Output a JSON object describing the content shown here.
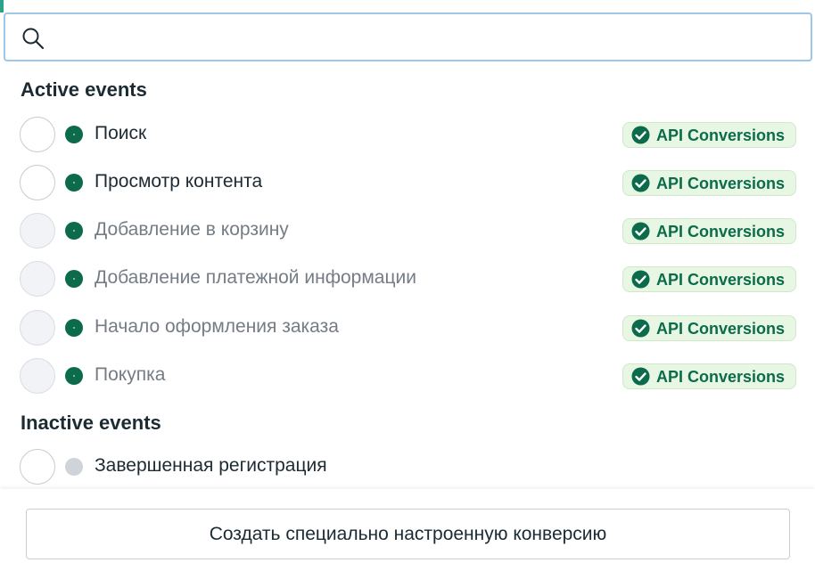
{
  "search": {
    "value": "",
    "placeholder": ""
  },
  "sections": {
    "active_title": "Active events",
    "inactive_title": "Inactive events"
  },
  "active_events": [
    {
      "label": "Поиск",
      "badge": "API Conversions",
      "enabled": true
    },
    {
      "label": "Просмотр контента",
      "badge": "API Conversions",
      "enabled": true
    },
    {
      "label": "Добавление в корзину",
      "badge": "API Conversions",
      "enabled": false
    },
    {
      "label": "Добавление платежной информации",
      "badge": "API Conversions",
      "enabled": false
    },
    {
      "label": "Начало оформления заказа",
      "badge": "API Conversions",
      "enabled": false
    },
    {
      "label": "Покупка",
      "badge": "API Conversions",
      "enabled": false
    }
  ],
  "inactive_events": [
    {
      "label": "Завершенная регистрация",
      "enabled": true
    }
  ],
  "footer": {
    "create_button_label": "Создать специально настроенную конверсию"
  },
  "colors": {
    "status_active": "#0c6b4a",
    "status_inactive": "#cfd4da",
    "badge_bg": "#e8f6e4",
    "search_border": "#9cc7e9",
    "accent": "#2aa38b"
  },
  "icons": {
    "search": "search-icon",
    "badge": "check-circle-icon",
    "status": "status-dot-icon"
  }
}
